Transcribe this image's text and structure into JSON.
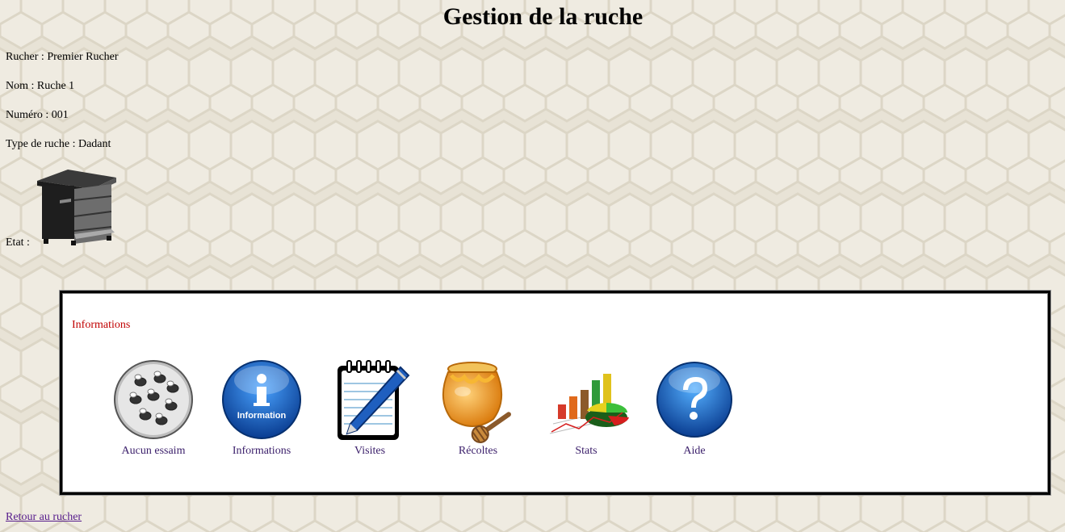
{
  "page": {
    "title": "Gestion de la ruche"
  },
  "hive_info": {
    "rucher": "Rucher : Premier Rucher",
    "nom": "Nom : Ruche 1",
    "numero": "Numéro : 001",
    "type": "Type de ruche : Dadant",
    "etat": "Etat :"
  },
  "panel": {
    "title": "Informations",
    "tiles": [
      {
        "label": "Aucun essaim",
        "icon": "bees-swarm-icon"
      },
      {
        "label": "Informations",
        "icon": "information-icon"
      },
      {
        "label": "Visites",
        "icon": "notepad-pen-icon"
      },
      {
        "label": "Récoltes",
        "icon": "honey-pot-icon"
      },
      {
        "label": "Stats",
        "icon": "stats-chart-icon"
      },
      {
        "label": "Aide",
        "icon": "help-icon"
      }
    ],
    "info_icon_text": "Information"
  },
  "footer": {
    "back_link": "Retour au rucher"
  },
  "colors": {
    "panel_title": "#c00000",
    "link": "#3a1e6a",
    "background": "#e9e4d8"
  }
}
